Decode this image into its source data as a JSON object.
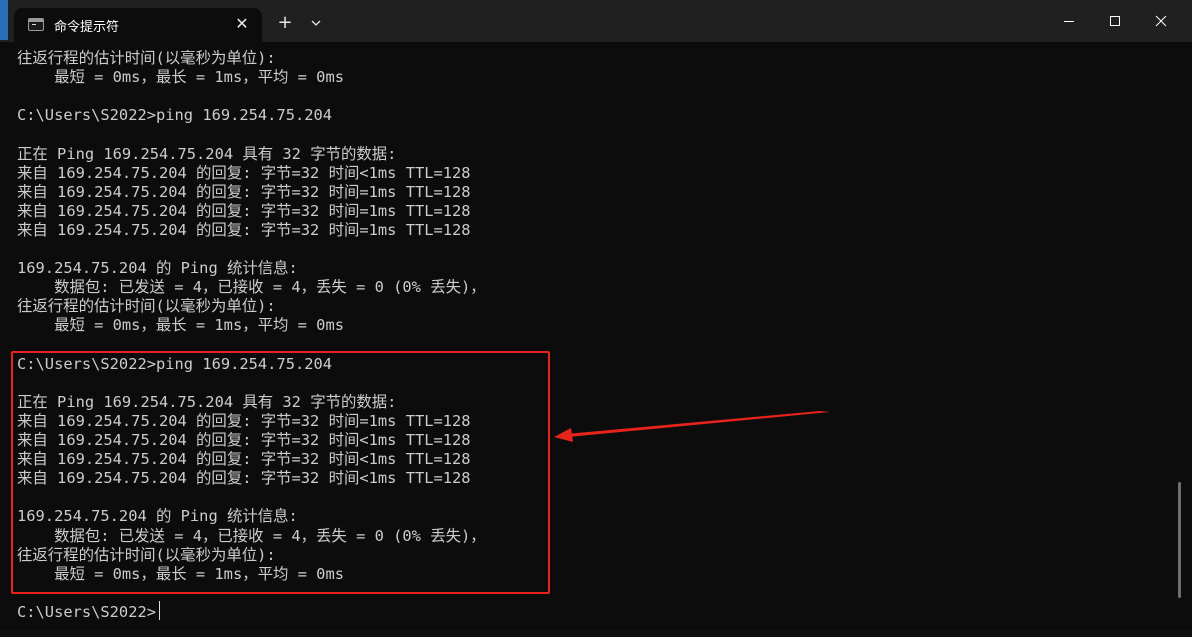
{
  "window": {
    "tab_title": "命令提示符",
    "tab_close": "✕",
    "new_tab": "+",
    "dropdown_icon": "chevron-down-icon",
    "controls": [
      "minimize-icon",
      "maximize-icon",
      "close-icon"
    ]
  },
  "terminal": {
    "lines": [
      "往返行程的估计时间(以毫秒为单位):",
      "    最短 = 0ms，最长 = 1ms，平均 = 0ms",
      "",
      "C:\\Users\\S2022>ping 169.254.75.204",
      "",
      "正在 Ping 169.254.75.204 具有 32 字节的数据:",
      "来自 169.254.75.204 的回复: 字节=32 时间<1ms TTL=128",
      "来自 169.254.75.204 的回复: 字节=32 时间=1ms TTL=128",
      "来自 169.254.75.204 的回复: 字节=32 时间=1ms TTL=128",
      "来自 169.254.75.204 的回复: 字节=32 时间=1ms TTL=128",
      "",
      "169.254.75.204 的 Ping 统计信息:",
      "    数据包: 已发送 = 4，已接收 = 4，丢失 = 0 (0% 丢失)，",
      "往返行程的估计时间(以毫秒为单位):",
      "    最短 = 0ms，最长 = 1ms，平均 = 0ms",
      "",
      "C:\\Users\\S2022>ping 169.254.75.204",
      "",
      "正在 Ping 169.254.75.204 具有 32 字节的数据:",
      "来自 169.254.75.204 的回复: 字节=32 时间=1ms TTL=128",
      "来自 169.254.75.204 的回复: 字节=32 时间<1ms TTL=128",
      "来自 169.254.75.204 的回复: 字节=32 时间<1ms TTL=128",
      "来自 169.254.75.204 的回复: 字节=32 时间<1ms TTL=128",
      "",
      "169.254.75.204 的 Ping 统计信息:",
      "    数据包: 已发送 = 4，已接收 = 4，丢失 = 0 (0% 丢失)，",
      "往返行程的估计时间(以毫秒为单位):",
      "    最短 = 0ms，最长 = 1ms，平均 = 0ms",
      "",
      "C:\\Users\\S2022>"
    ]
  },
  "annotation": {
    "color": "#e8231c"
  },
  "colors": {
    "terminal_bg": "#0c0c0c",
    "titlebar_bg": "#202020",
    "text": "#cccccc"
  }
}
